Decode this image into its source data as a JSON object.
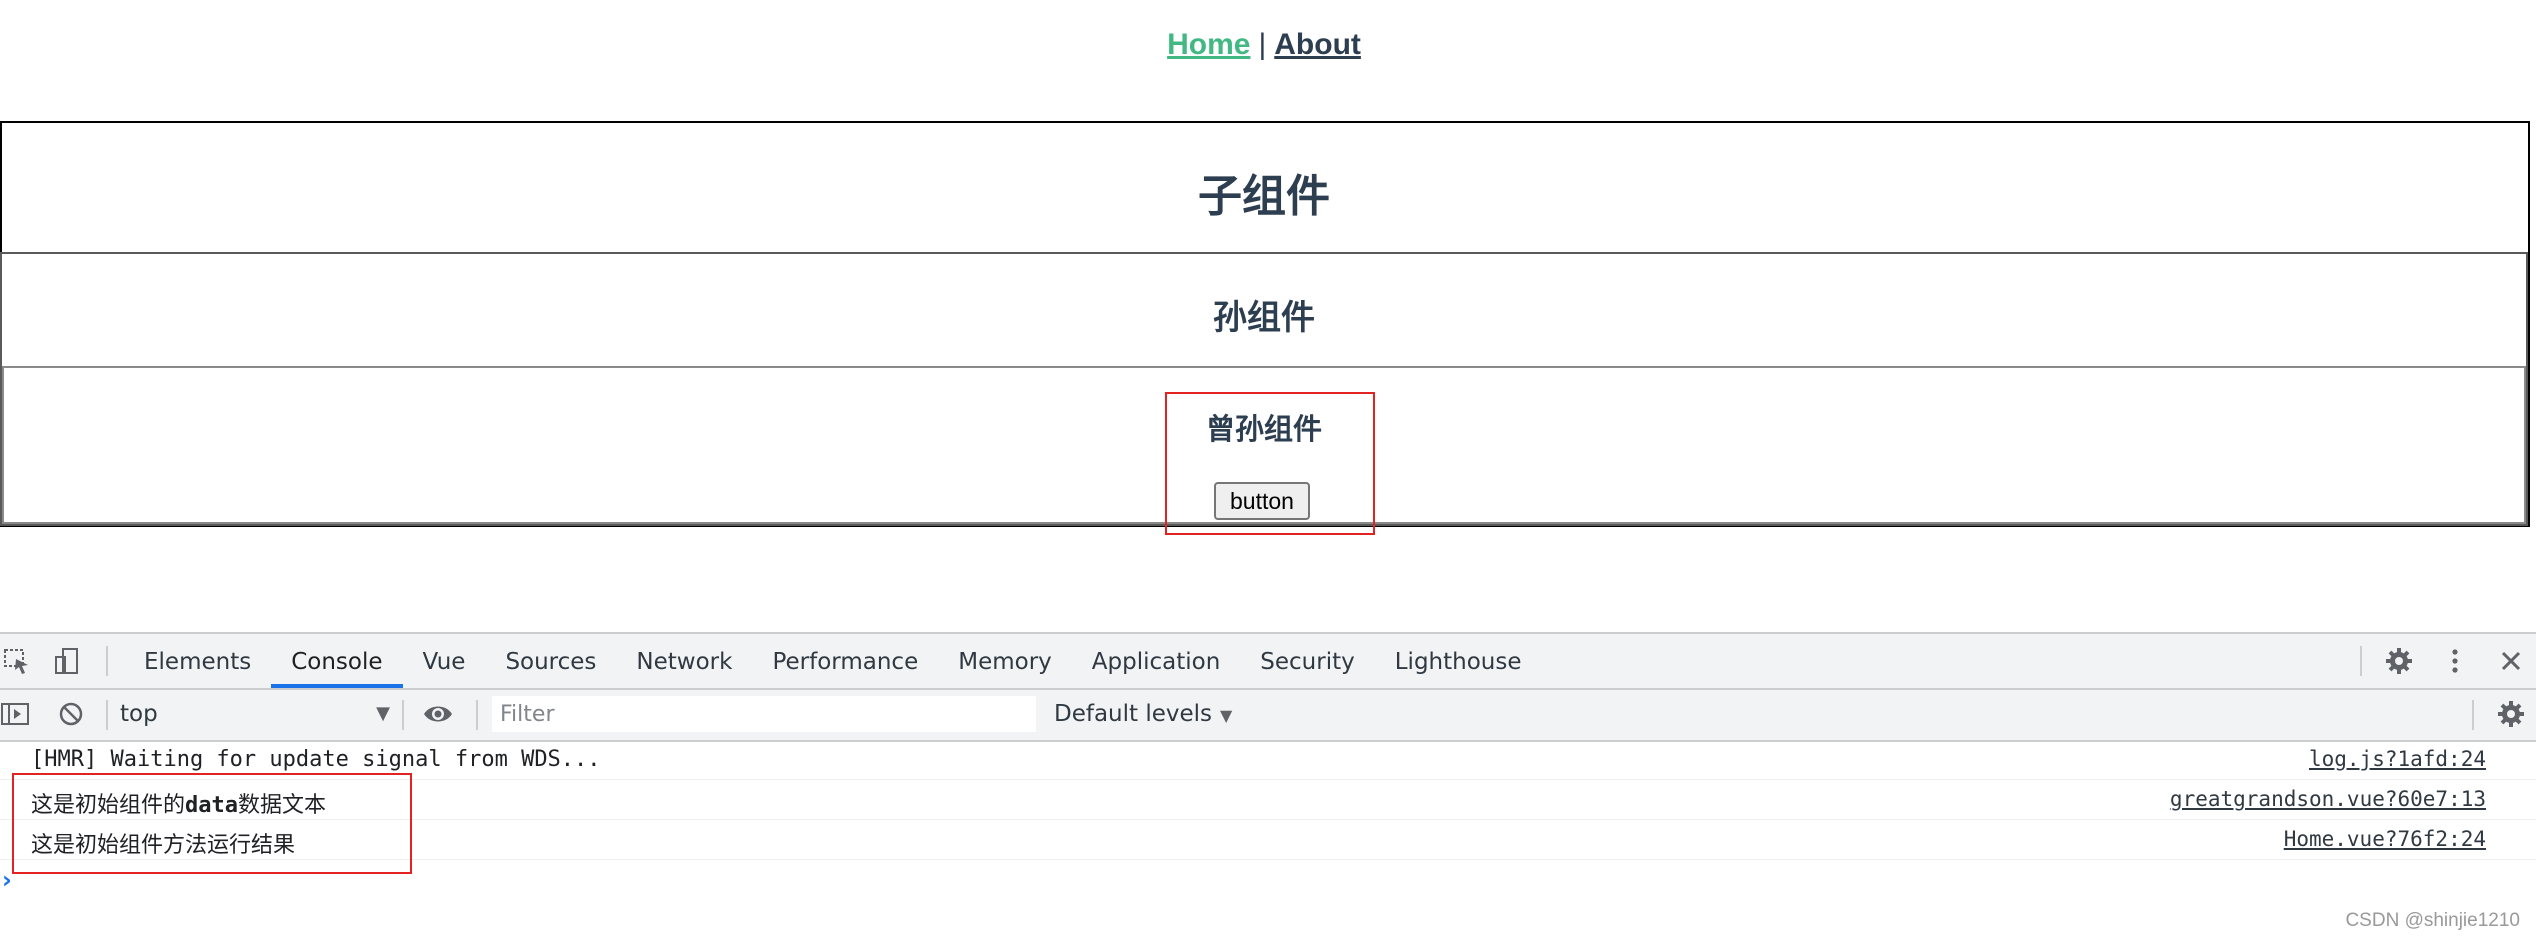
{
  "nav": {
    "home": "Home",
    "separator": "|",
    "about": "About"
  },
  "app": {
    "child_title": "子组件",
    "grandchild_title": "孙组件",
    "greatgrandson_title": "曾孙组件",
    "button_label": "button"
  },
  "colors": {
    "nav_active": "#42b983",
    "heading": "#2c3e50",
    "highlight": "#e32322",
    "devtools_accent": "#1a73e8"
  },
  "devtools": {
    "tabs": [
      "Elements",
      "Console",
      "Vue",
      "Sources",
      "Network",
      "Performance",
      "Memory",
      "Application",
      "Security",
      "Lighthouse"
    ],
    "active_tab": "Console",
    "icons": [
      "inspect-icon",
      "device-toggle-icon",
      "settings-icon",
      "more-icon",
      "close-icon"
    ],
    "context": "top",
    "filter_placeholder": "Filter",
    "filter_value": "",
    "levels": "Default levels",
    "logs": [
      {
        "message": "[HMR] Waiting for update signal from WDS...",
        "source": "log.js?1afd:24"
      },
      {
        "message_prefix": "这是初始组件的",
        "message_bold": "data",
        "message_suffix": "数据文本",
        "source": "greatgrandson.vue?60e7:13"
      },
      {
        "message": "这是初始组件方法运行结果",
        "source": "Home.vue?76f2:24"
      }
    ]
  },
  "watermark": "CSDN @shinjie1210"
}
